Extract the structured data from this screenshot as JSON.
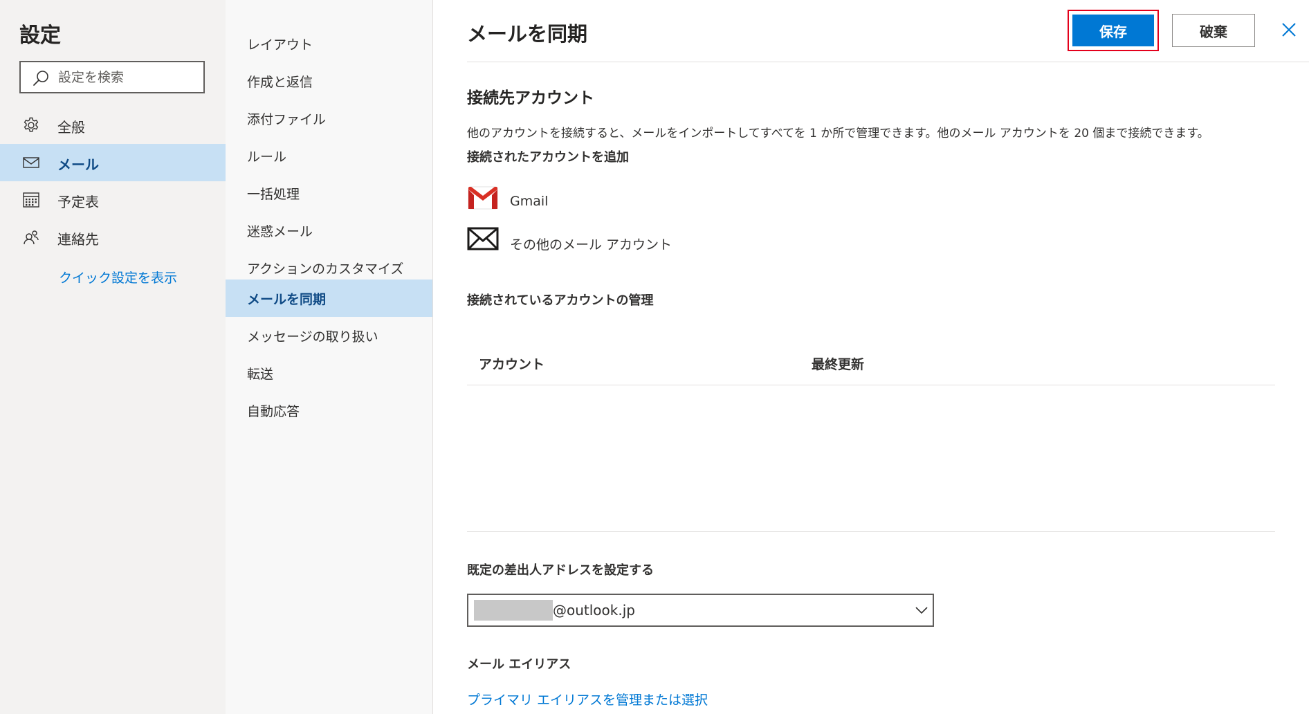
{
  "settings": {
    "title": "設定",
    "search_placeholder": "設定を検索",
    "categories": [
      {
        "label": "全般",
        "icon": "gear-icon"
      },
      {
        "label": "メール",
        "icon": "mail-icon"
      },
      {
        "label": "予定表",
        "icon": "calendar-icon"
      },
      {
        "label": "連絡先",
        "icon": "people-icon"
      }
    ],
    "active_category": "メール",
    "quick_settings_link": "クイック設定を表示"
  },
  "mail_nav": {
    "items": [
      "レイアウト",
      "作成と返信",
      "添付ファイル",
      "ルール",
      "一括処理",
      "迷惑メール",
      "アクションのカスタマイズ",
      "メールを同期",
      "メッセージの取り扱い",
      "転送",
      "自動応答"
    ],
    "active_item": "メールを同期"
  },
  "main": {
    "title": "メールを同期",
    "save_label": "保存",
    "discard_label": "破棄",
    "connected_section": {
      "title": "接続先アカウント",
      "description": "他のアカウントを接続すると、メールをインポートしてすべてを 1 か所で管理できます。他のメール アカウントを 20 個まで接続できます。",
      "add_title": "接続されたアカウントを追加",
      "options": [
        {
          "label": "Gmail",
          "icon": "gmail-icon"
        },
        {
          "label": "その他のメール アカウント",
          "icon": "envelope-icon"
        }
      ]
    },
    "manage_section": {
      "title": "接続されているアカウントの管理",
      "columns": [
        "アカウント",
        "最終更新"
      ]
    },
    "default_from": {
      "title": "既定の差出人アドレスを設定する",
      "selected_value": "@outlook.jp"
    },
    "alias_section": {
      "title": "メール エイリアス",
      "link": "プライマリ エイリアスを管理または選択"
    }
  },
  "colors": {
    "accent": "#0078d4",
    "active_background": "#c7e0f4",
    "highlight_border": "#e3001b",
    "gmail_red": "#d93025"
  }
}
